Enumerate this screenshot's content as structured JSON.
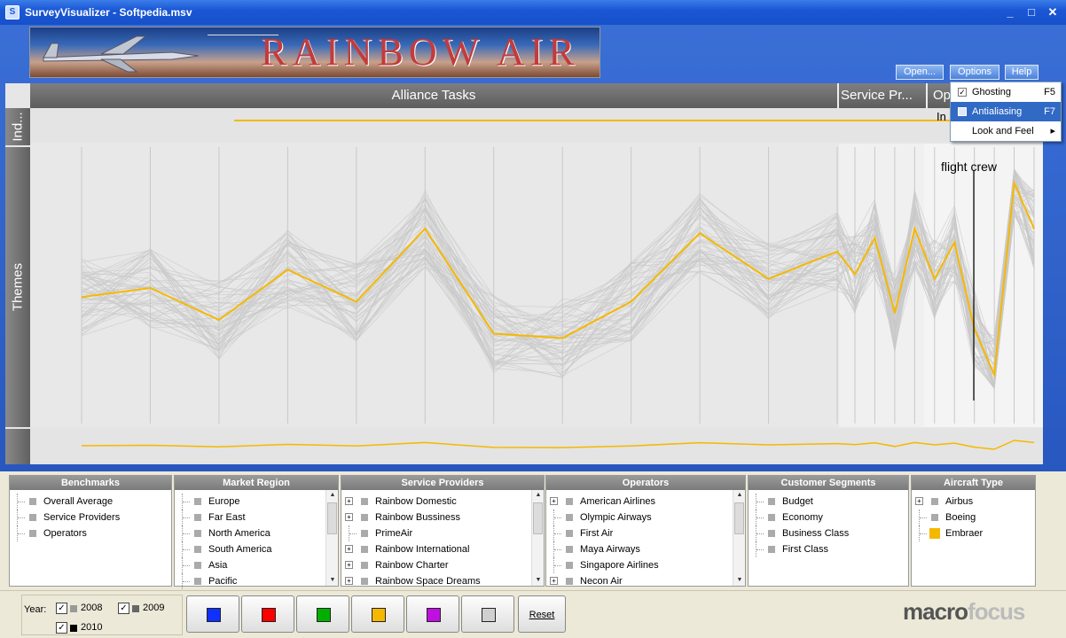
{
  "window": {
    "title": "SurveyVisualizer - Softpedia.msv",
    "app_icon_glyph": "S",
    "minimize": "_",
    "maximize": "□",
    "close": "✕"
  },
  "banner": {
    "title": "RAINBOW AIR"
  },
  "toolbar": {
    "open_label": "Open...",
    "options_label": "Options",
    "help_label": "Help"
  },
  "options_menu": {
    "items": [
      {
        "label": "Ghosting",
        "shortcut": "F5",
        "checked": "✓"
      },
      {
        "label": "Antialiasing",
        "shortcut": "F7",
        "checked": ""
      },
      {
        "label": "Look and Feel",
        "submenu_arrow": "▸"
      }
    ]
  },
  "plot": {
    "headers": [
      "Alliance Tasks",
      "Service Pr...",
      "Op"
    ],
    "header_extra": "In",
    "side_labels": [
      "Ind...",
      "Themes"
    ],
    "highlight_label": "flight crew",
    "series_colors": {
      "highlight": "#f5b800",
      "background": "#c9c9c9"
    }
  },
  "chart_data": {
    "type": "line",
    "series": [
      {
        "values": [
          0.42,
          0.46,
          0.32,
          0.54,
          0.4,
          0.72,
          0.26,
          0.24,
          0.4,
          0.7,
          0.5,
          0.62,
          0.52,
          0.68,
          0.35,
          0.72,
          0.5,
          0.66,
          0.28,
          0.08,
          0.92,
          0.72
        ]
      }
    ]
  },
  "filters": {
    "benchmarks": {
      "title": "Benchmarks",
      "items": [
        "Overall Average",
        "Service Providers",
        "Operators"
      ]
    },
    "market_region": {
      "title": "Market Region",
      "items": [
        "Europe",
        "Far East",
        "North America",
        "South America",
        "Asia",
        "Pacific"
      ]
    },
    "service_providers": {
      "title": "Service Providers",
      "items": [
        "Rainbow Domestic",
        "Rainbow Bussiness",
        "PrimeAir",
        "Rainbow International",
        "Rainbow Charter",
        "Rainbow Space Dreams"
      ]
    },
    "operators": {
      "title": "Operators",
      "items": [
        "American Airlines",
        "Olympic Airways",
        "First Air",
        "Maya Airways",
        "Singapore Airlines",
        "Necon Air"
      ]
    },
    "customer_segments": {
      "title": "Customer Segments",
      "items": [
        "Budget",
        "Economy",
        "Business Class",
        "First Class"
      ]
    },
    "aircraft_type": {
      "title": "Aircraft Type",
      "items": [
        "Airbus",
        "Boeing",
        "Embraer"
      ],
      "accent": "#f5b800"
    }
  },
  "bottom": {
    "year_label": "Year:",
    "years": [
      "2008",
      "2009",
      "2010"
    ],
    "check": "✓",
    "colors": [
      "#1030ff",
      "#ff0000",
      "#00b000",
      "#f5b800",
      "#c010e0",
      "#d0d0d0"
    ],
    "reset_label": "Reset",
    "brand_a": "macro",
    "brand_b": "focus"
  }
}
